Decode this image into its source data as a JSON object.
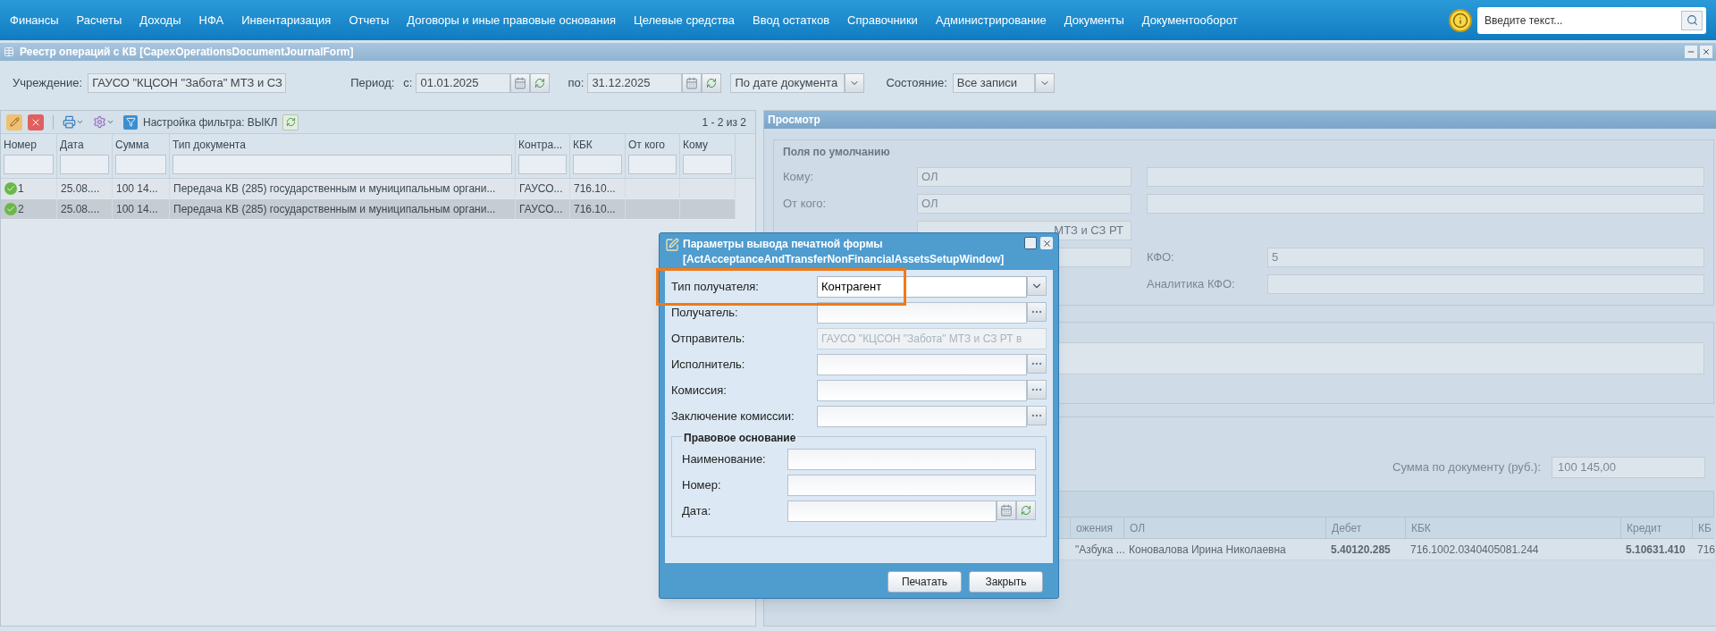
{
  "menu": [
    "Финансы",
    "Расчеты",
    "Доходы",
    "НФА",
    "Инвентаризация",
    "Отчеты",
    "Договоры и иные правовые основания",
    "Целевые средства",
    "Ввод остатков",
    "Справочники",
    "Администрирование",
    "Документы",
    "Документооборот"
  ],
  "search": {
    "placeholder": "Введите текст..."
  },
  "window": {
    "title": "Реестр операций с КВ [CapexOperationsDocumentJournalForm]"
  },
  "filters": {
    "institution": {
      "label": "Учреждение:",
      "value": "ГАУСО \"КЦСОН \"Забота\" МТЗ и СЗ"
    },
    "period_label": "Период:",
    "from": {
      "label": "с:",
      "value": "01.01.2025"
    },
    "to": {
      "label": "по:",
      "value": "31.12.2025"
    },
    "date_mode": "По дате документа",
    "state": {
      "label": "Состояние:",
      "value": "Все записи"
    }
  },
  "toolbar": {
    "filter_setting": "Настройка фильтра: ВЫКЛ",
    "paging": "1 - 2 из 2"
  },
  "table": {
    "columns": [
      "Номер",
      "Дата",
      "Сумма",
      "Тип документа",
      "Контра...",
      "КБК",
      "От кого",
      "Кому"
    ],
    "rows": [
      {
        "selected": false,
        "cells": [
          "1",
          "25.08....",
          "100 14...",
          "Передача КВ (285) государственным и муниципальным органи...",
          "ГАУСО...",
          "716.10..."
        ]
      },
      {
        "selected": true,
        "cells": [
          "2",
          "25.08....",
          "100 14...",
          "Передача КВ (285) государственным и муниципальным органи...",
          "ГАУСО...",
          "716.10..."
        ]
      }
    ]
  },
  "preview": {
    "title": "Просмотр",
    "legend": "Поля по умолчанию",
    "to_row": {
      "label": "Кому:",
      "value": "ОЛ"
    },
    "from_row": {
      "label": "От кого:",
      "value": "ОЛ"
    },
    "sender_value": "МТЗ и СЗ РТ",
    "kfo": {
      "label": "КФО:",
      "value": "5"
    },
    "kfo_analytics": {
      "label": "Аналитика КФО:"
    },
    "sum": {
      "label": "Сумма по документу (руб.):",
      "value": "100 145,00"
    },
    "grid": {
      "columns": [
        "ожения",
        "ОЛ",
        "Дебет",
        "КБК",
        "Кредит",
        "КБ"
      ],
      "rows": [
        {
          "cells": [
            {
              "text": "\"Азбука ...",
              "bold": false
            },
            {
              "text": "Коновалова Ирина Николаевна",
              "bold": false
            },
            {
              "text": "5.40120.285",
              "bold": true
            },
            {
              "text": "716.1002.0340405081.244",
              "bold": false
            },
            {
              "text": "5.10631.410",
              "bold": true
            },
            {
              "text": "716",
              "bold": false
            }
          ]
        }
      ]
    }
  },
  "dialog": {
    "title": "Параметры вывода печатной формы",
    "subtitle": "[ActAcceptanceAndTransferNonFinancialAssetsSetupWindow]",
    "fields": [
      {
        "kind": "select",
        "label": "Тип получателя:",
        "value": "Контрагент"
      },
      {
        "kind": "lookup",
        "label": "Получатель:"
      },
      {
        "kind": "readonly",
        "label": "Отправитель:",
        "value": "ГАУСО \"КЦСОН \"Забота\" МТЗ и СЗ РТ в"
      },
      {
        "kind": "lookup",
        "label": "Исполнитель:"
      },
      {
        "kind": "lookup",
        "label": "Комиссия:"
      },
      {
        "kind": "lookup",
        "label": "Заключение комиссии:"
      }
    ],
    "legal": {
      "legend": "Правовое основание",
      "fields": [
        {
          "kind": "text",
          "label": "Наименование:"
        },
        {
          "kind": "text",
          "label": "Номер:"
        },
        {
          "kind": "date",
          "label": "Дата:"
        }
      ]
    },
    "buttons": [
      "Печатать",
      "Закрыть"
    ]
  }
}
